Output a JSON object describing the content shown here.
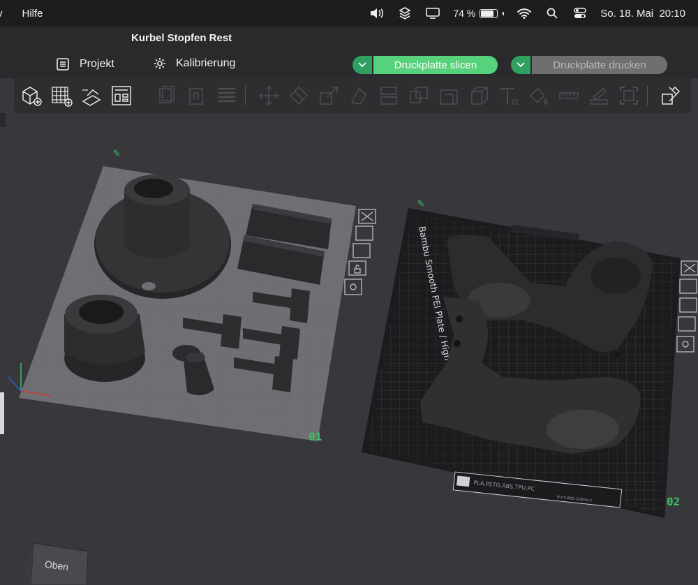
{
  "menubar": {
    "left_items": [
      "v",
      "Hilfe"
    ],
    "battery_percent": "74 %",
    "battery_level": 0.74,
    "datetime": "So. 18. Mai  20:10",
    "icons": [
      "volume-icon",
      "layers-icon",
      "display-icon",
      "battery-icon",
      "wifi-icon",
      "search-icon",
      "control-center-icon"
    ]
  },
  "app": {
    "title": "Kurbel Stopfen Rest",
    "tabs": [
      {
        "label": "Projekt",
        "icon": "list-icon"
      },
      {
        "label": "Kalibrierung",
        "icon": "gear-icon"
      }
    ],
    "slice_button": "Druckplatte slicen",
    "print_button": "Druckplatte drucken",
    "colors": {
      "accent": "#57d27c",
      "accent_dark": "#2fa060",
      "disabled": "#6f6f72"
    }
  },
  "toolbar": {
    "tools": [
      "add-part-icon",
      "add-plate-icon",
      "auto-arrange-icon",
      "plate-layout-icon",
      "copy-icon",
      "paste-icon",
      "list-view-icon",
      "move-icon",
      "rotate-icon",
      "scale-icon",
      "place-face-icon",
      "cut-icon",
      "split-parts-icon",
      "boolean-icon",
      "support-paint-icon",
      "seam-icon",
      "text-icon",
      "color-paint-icon",
      "measure-icon",
      "assembly-icon",
      "fit-icon",
      "variable-layer-icon"
    ]
  },
  "plates": [
    {
      "number": "01",
      "label_icon": "edit-icon"
    },
    {
      "number": "02",
      "label_icon": "edit-icon",
      "bed_text": "Bambu Smooth PEI Plate / High Temp Plate",
      "material_text": "PLA,PETG,ABS,TPU,PC",
      "surface_text": "TEXTURED SURFACE"
    }
  ],
  "view_cube": {
    "label": "Oben"
  },
  "plate_controls": [
    "close-icon",
    "arrange-icon",
    "layout-icon",
    "lock-icon",
    "settings-icon"
  ]
}
